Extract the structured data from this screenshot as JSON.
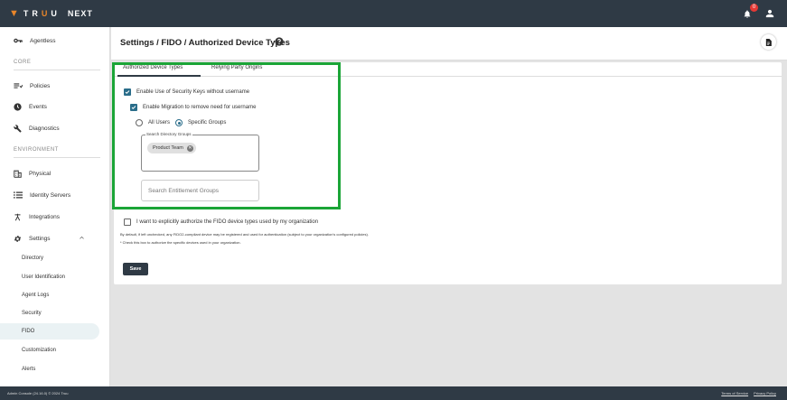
{
  "brand": {
    "logo_letters": [
      "T",
      "R",
      "U",
      "U"
    ],
    "product": "NEXT",
    "accent_color": "#e9862a"
  },
  "header": {
    "notification_count": "0"
  },
  "sidebar": {
    "agentless": "Agentless",
    "core_label": "CORE",
    "policies": "Policies",
    "events": "Events",
    "diagnostics": "Diagnostics",
    "environment_label": "ENVIRONMENT",
    "physical": "Physical",
    "identity_servers": "Identity Servers",
    "integrations": "Integrations",
    "settings": "Settings",
    "settings_children": {
      "directory": "Directory",
      "user_identification": "User Identification",
      "agent_logs": "Agent Logs",
      "security": "Security",
      "fido": "FIDO",
      "customization": "Customization",
      "alerts": "Alerts"
    },
    "active_item": "FIDO"
  },
  "page": {
    "title": "Settings / FIDO / Authorized Device Types"
  },
  "tabs": {
    "authorized": "Authorized Device Types",
    "relying": "Relying Party Origins",
    "active": "Authorized Device Types"
  },
  "form": {
    "enable_keys_label": "Enable Use of Security Keys without username",
    "enable_keys_checked": true,
    "enable_migration_label": "Enable Migration to remove need for username",
    "enable_migration_checked": true,
    "all_users_label": "All Users",
    "specific_groups_label": "Specific Groups",
    "selected_scope": "Specific Groups",
    "search_groups_legend": "Search Directory Groups",
    "group_chip": "Product Team",
    "entitlement_placeholder": "Search Entitlement Groups",
    "authorize_label": "I want to explicitly authorize the FIDO device types used by my organization",
    "authorize_checked": false,
    "hint_line1": "By default, if left unchecked, any FIDO2-compliant device may be registered and used for authentication (subject to your organization's configured policies).",
    "hint_line2": "* Check this box to authorize the specific devices used in your organization.",
    "save_label": "Save"
  },
  "footer": {
    "left": "Admin Console (24.16.0) © 2024 Truu",
    "terms": "Terms of Service",
    "privacy": "Privacy Policy"
  },
  "colors": {
    "topbar": "#2f3a45",
    "checkbox": "#2a6d8a",
    "highlight": "#1ba537"
  }
}
